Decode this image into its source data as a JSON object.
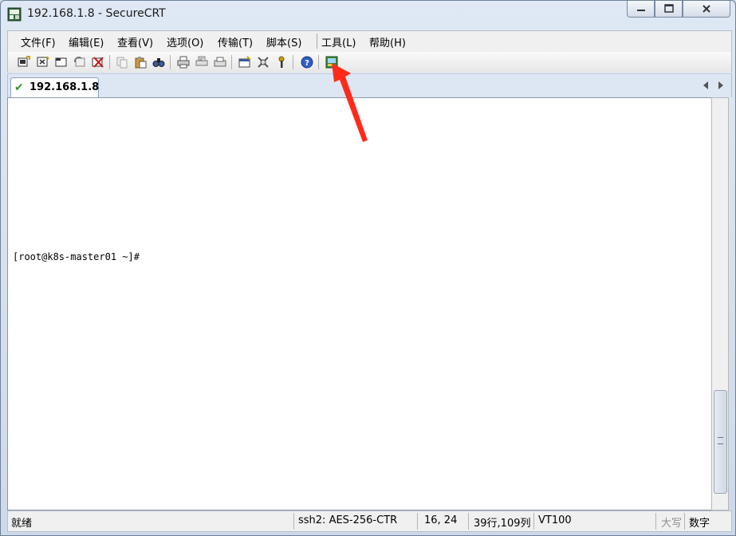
{
  "window": {
    "title": "192.168.1.8 - SecureCRT",
    "caption_buttons": [
      "minimize-icon",
      "maximize-icon",
      "close-icon"
    ]
  },
  "menubar": {
    "items": [
      "文件(F)",
      "编辑(E)",
      "查看(V)",
      "选项(O)",
      "传输(T)",
      "脚本(S)",
      "工具(L)",
      "帮助(H)"
    ]
  },
  "toolbar": {
    "buttons": [
      "connect-icon",
      "quick-connect-icon",
      "connect-in-tab-icon",
      "reconnect-icon",
      "disconnect-icon",
      "copy-icon",
      "paste-icon",
      "find-icon",
      "print-icon",
      "print-selection-icon",
      "print-setup-icon",
      "session-options-icon",
      "global-options-icon",
      "keymap-icon",
      "help-icon",
      "sftp-icon"
    ],
    "highlighted_button": "sftp-icon"
  },
  "tabs": [
    {
      "label": "192.168.1.8",
      "status": "connected"
    }
  ],
  "terminal": {
    "prompt": "[root@k8s-master01 ~]#"
  },
  "statusbar": {
    "ready": "就绪",
    "cipher": "ssh2: AES-256-CTR",
    "cursor": "16,  24",
    "size": "39行,109列",
    "emulation": "VT100",
    "caps": "大写",
    "num": "数字"
  },
  "annotation": {
    "arrow_color": "#ff2a1a"
  }
}
